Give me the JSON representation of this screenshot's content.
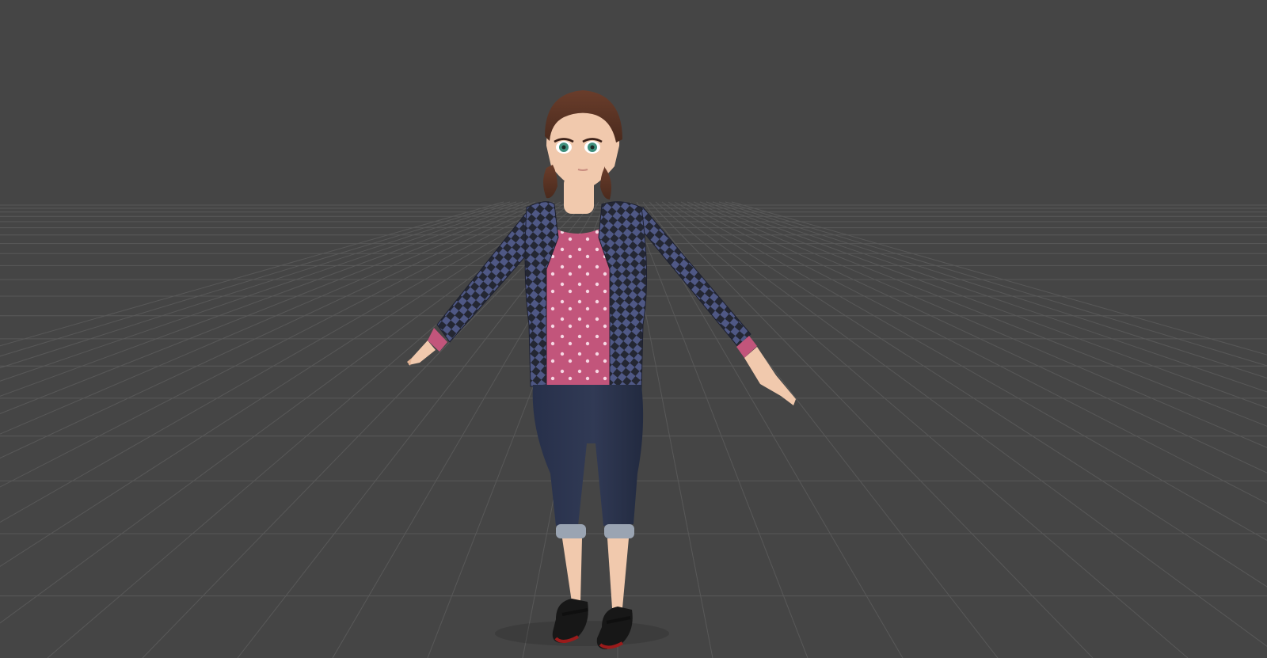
{
  "viewport": {
    "mode": "3d-perspective",
    "background_color": "#454545",
    "grid_color": "#5a5a5a",
    "grid_visible": true
  },
  "model": {
    "pose": "t-pose",
    "hair_color": "#5b3323",
    "skin_color": "#f1c9ad",
    "eye_color": "#3f8f7d",
    "jacket_pattern": "checkerboard",
    "jacket_colors": [
      "#4f5885",
      "#242733"
    ],
    "top_color": "#c2557b",
    "top_pattern": "polka-dots",
    "pants_color": "#313a55",
    "cuff_color": "#9aa4b2",
    "shoe_color": "#171717",
    "sole_color": "#9b1b1b"
  }
}
